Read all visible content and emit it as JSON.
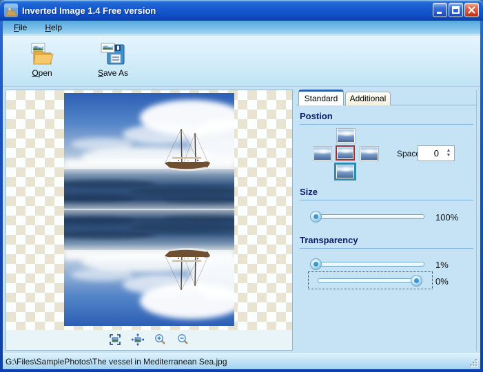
{
  "window": {
    "title": "Inverted Image 1.4 Free version",
    "app_icon": "mountain-photo-icon",
    "buttons": {
      "minimize": "minimize-icon",
      "maximize": "maximize-icon",
      "close": "close-icon"
    }
  },
  "menu": {
    "items": [
      {
        "label": "File"
      },
      {
        "label": "Help"
      }
    ]
  },
  "toolbar": {
    "buttons": [
      {
        "label": "Open",
        "icon": "open-folder-icon"
      },
      {
        "label": "Save As",
        "icon": "save-floppy-icon"
      }
    ]
  },
  "preview": {
    "zoom_tools": [
      "fit-window-icon",
      "actual-size-icon",
      "zoom-in-icon",
      "zoom-out-icon"
    ],
    "image_description": "Sailing vessel on Mediterranean sea with mirrored reflection below"
  },
  "panel": {
    "tabs": [
      "Standard",
      "Additional"
    ],
    "active_tab": "Standard",
    "position": {
      "heading": "Postion",
      "space_label": "Space",
      "space_value": "0",
      "thumbs": [
        {
          "pos": "top",
          "selected": false
        },
        {
          "pos": "left",
          "selected": false
        },
        {
          "pos": "center",
          "selected": true,
          "highlight": "red"
        },
        {
          "pos": "right",
          "selected": false
        },
        {
          "pos": "bottom",
          "selected": true,
          "highlight": "teal"
        }
      ]
    },
    "size": {
      "heading": "Size",
      "value": "100%"
    },
    "transparency": {
      "heading": "Transparency",
      "slider1_value": "1%",
      "slider2_value": "0%"
    }
  },
  "statusbar": {
    "path": "G:\\Files\\SamplePhotos\\The vessel in Mediterranean Sea.jpg"
  },
  "colors": {
    "titlebar_blue": "#1557cc",
    "panel_bg": "#c5e3f4",
    "heading_navy": "#0a1d63",
    "select_red": "#9c3438",
    "select_teal": "#2e8cab",
    "checker_beige": "#e9e4d2"
  }
}
